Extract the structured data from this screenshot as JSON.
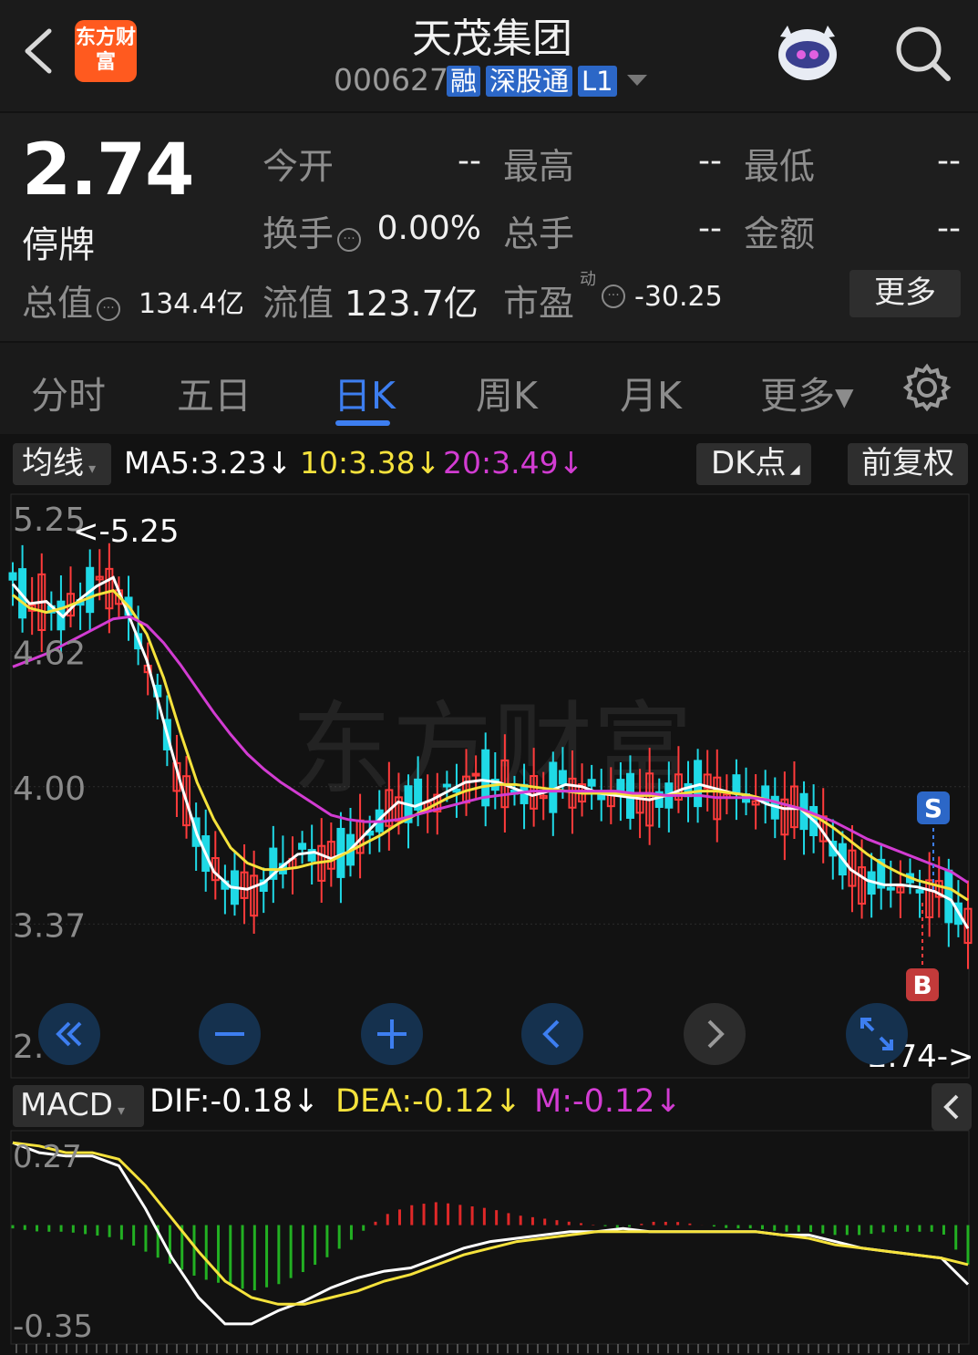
{
  "header": {
    "stock_name": "天茂集团",
    "code": "000627",
    "tags": [
      "融",
      "深股通",
      "L1"
    ],
    "logo_text": "东方财富",
    "icons": [
      "back-arrow-icon",
      "robot-avatar-icon",
      "search-icon",
      "chevron-down-icon"
    ]
  },
  "quote": {
    "price": "2.74",
    "status": "停牌",
    "open_label": "今开",
    "open_value": "--",
    "high_label": "最高",
    "high_value": "--",
    "low_label": "最低",
    "low_value": "--",
    "turnover_label": "换手",
    "turnover_value": "0.00%",
    "volume_label": "总手",
    "volume_value": "--",
    "amount_label": "金额",
    "amount_value": "--",
    "mktcap_label": "总值",
    "mktcap_value": "134.4亿",
    "float_label": "流值",
    "float_value": "123.7亿",
    "pe_label": "市盈",
    "pe_sup": "动",
    "pe_value": "-30.25",
    "more_button": "更多"
  },
  "tabs": [
    {
      "label": "分时"
    },
    {
      "label": "五日"
    },
    {
      "label": "日K",
      "active": true
    },
    {
      "label": "周K"
    },
    {
      "label": "月K"
    },
    {
      "label": "更多▾"
    }
  ],
  "ma_row": {
    "selector": "均线",
    "ma5": "MA5:3.23↓",
    "ma10": "10:3.38↓",
    "ma20": "20:3.49↓",
    "dk_button": "DK点",
    "adjust_button": "前复权"
  },
  "macd_row": {
    "selector": "MACD",
    "dif": "DIF:-0.18↓",
    "dea": "DEA:-0.12↓",
    "m": "M:-0.12↓"
  },
  "colors": {
    "up": "#ff3b3b",
    "down": "#1fd9e6",
    "ma5": "#ffffff",
    "ma10": "#f5e23c",
    "ma20": "#d23cd2",
    "accent": "#3d7ef0",
    "macd_up": "#e02828",
    "macd_down": "#22b022"
  },
  "chart_data": [
    {
      "type": "candlestick",
      "y_ticks": [
        "5.25",
        "4.62",
        "4.00",
        "3.37",
        "2.74"
      ],
      "ylim": [
        2.74,
        5.25
      ],
      "annotations": {
        "max_label": "<-5.25",
        "last_label": "2.74->",
        "sell_marker": "S",
        "buy_marker": "B"
      },
      "series": [
        {
          "name": "MA5",
          "values": [
            4.93,
            4.84,
            4.85,
            4.78,
            4.86,
            4.92,
            4.96,
            4.77,
            4.58,
            4.3,
            4.02,
            3.78,
            3.61,
            3.54,
            3.53,
            3.56,
            3.63,
            3.69,
            3.7,
            3.67,
            3.7,
            3.78,
            3.86,
            3.93,
            3.91,
            3.94,
            3.98,
            4.02,
            4.03,
            4.02,
            3.99,
            3.96,
            3.98,
            4.01,
            4.0,
            3.97,
            3.96,
            3.95,
            3.94,
            3.96,
            3.99,
            4.01,
            3.99,
            3.97,
            3.96,
            3.92,
            3.9,
            3.9,
            3.83,
            3.72,
            3.62,
            3.57,
            3.55,
            3.55,
            3.54,
            3.52,
            3.48,
            3.35
          ]
        },
        {
          "name": "MA10",
          "values": [
            4.88,
            4.82,
            4.8,
            4.82,
            4.85,
            4.88,
            4.9,
            4.82,
            4.7,
            4.5,
            4.25,
            4.02,
            3.85,
            3.72,
            3.65,
            3.62,
            3.62,
            3.63,
            3.65,
            3.66,
            3.7,
            3.74,
            3.78,
            3.83,
            3.87,
            3.91,
            3.95,
            3.98,
            4.0,
            4.01,
            4.01,
            4.0,
            3.99,
            3.98,
            3.97,
            3.97,
            3.97,
            3.96,
            3.96,
            3.96,
            3.97,
            3.98,
            3.98,
            3.97,
            3.96,
            3.94,
            3.92,
            3.9,
            3.86,
            3.81,
            3.75,
            3.69,
            3.64,
            3.6,
            3.57,
            3.55,
            3.53,
            3.48
          ]
        },
        {
          "name": "MA20",
          "values": [
            4.55,
            4.58,
            4.61,
            4.65,
            4.69,
            4.73,
            4.77,
            4.78,
            4.74,
            4.66,
            4.56,
            4.45,
            4.34,
            4.24,
            4.15,
            4.08,
            4.02,
            3.97,
            3.92,
            3.87,
            3.85,
            3.84,
            3.84,
            3.85,
            3.87,
            3.89,
            3.91,
            3.93,
            3.95,
            3.96,
            3.97,
            3.98,
            3.98,
            3.98,
            3.98,
            3.98,
            3.98,
            3.97,
            3.97,
            3.96,
            3.96,
            3.96,
            3.95,
            3.95,
            3.95,
            3.94,
            3.92,
            3.9,
            3.87,
            3.84,
            3.8,
            3.76,
            3.73,
            3.7,
            3.67,
            3.64,
            3.61,
            3.56
          ]
        }
      ]
    },
    {
      "type": "bar+line",
      "name": "MACD",
      "y_ticks": [
        "0.27",
        "-0.35"
      ],
      "ylim": [
        -0.35,
        0.27
      ],
      "series": [
        {
          "name": "DIF",
          "values": [
            0.25,
            0.22,
            0.21,
            0.21,
            0.18,
            0.05,
            -0.1,
            -0.22,
            -0.3,
            -0.3,
            -0.26,
            -0.23,
            -0.19,
            -0.16,
            -0.14,
            -0.13,
            -0.1,
            -0.07,
            -0.05,
            -0.04,
            -0.03,
            -0.02,
            -0.02,
            -0.01,
            -0.02,
            -0.02,
            -0.02,
            -0.02,
            -0.02,
            -0.03,
            -0.03,
            -0.05,
            -0.07,
            -0.08,
            -0.09,
            -0.1,
            -0.18
          ]
        },
        {
          "name": "DEA",
          "values": [
            0.25,
            0.24,
            0.22,
            0.22,
            0.2,
            0.12,
            0.02,
            -0.08,
            -0.17,
            -0.22,
            -0.24,
            -0.24,
            -0.22,
            -0.2,
            -0.17,
            -0.15,
            -0.12,
            -0.09,
            -0.07,
            -0.05,
            -0.04,
            -0.03,
            -0.02,
            -0.02,
            -0.02,
            -0.02,
            -0.02,
            -0.02,
            -0.02,
            -0.03,
            -0.04,
            -0.06,
            -0.07,
            -0.08,
            -0.09,
            -0.1,
            -0.12
          ]
        },
        {
          "name": "M",
          "values": [
            -0.01,
            -0.02,
            -0.02,
            -0.03,
            -0.04,
            -0.08,
            -0.12,
            -0.16,
            -0.18,
            -0.2,
            -0.18,
            -0.14,
            -0.09,
            -0.03,
            0.03,
            0.06,
            0.07,
            0.06,
            0.05,
            0.03,
            0.02,
            0.01,
            0.0,
            -0.01,
            0.01,
            0.01,
            0.0,
            -0.01,
            -0.01,
            -0.02,
            -0.02,
            -0.03,
            -0.03,
            -0.02,
            -0.02,
            -0.02,
            -0.12
          ]
        }
      ]
    }
  ]
}
